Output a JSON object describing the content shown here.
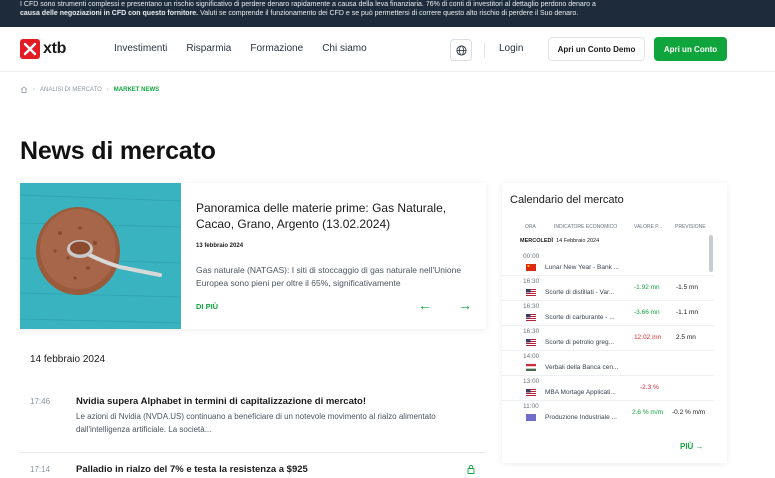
{
  "warning": {
    "line1": "I CFD sono strumenti complessi e presentano un rischio significativo di perdere denaro rapidamente a causa della leva finanziaria. 76% di conti di investitori al dettaglio perdono denaro a",
    "line2_bold": "causa delle negoziazioni in CFD con questo fornitore.",
    "line2_rest": " Valuti se comprende il funzionamento dei CFD e se può permettersi di correre questo alto rischio di perdere il Suo denaro."
  },
  "nav": {
    "logo_text": "xtb",
    "menu": [
      "Investimenti",
      "Risparmia",
      "Formazione",
      "Chi siamo"
    ],
    "login": "Login",
    "demo": "Apri un Conto Demo",
    "open": "Apri un Conto"
  },
  "breadcrumb": {
    "item1": "ANALISI DI MERCATO",
    "item2": "MARKET NEWS"
  },
  "page_title": "News di mercato",
  "featured": {
    "title": "Panoramica delle materie prime: Gas Naturale, Cacao, Grano, Argento (13.02.2024)",
    "date": "13 febbraio 2024",
    "body": "Gas naturale (NATGAS): I siti di stoccaggio di gas naturale nell'Unione Europea sono pieni per oltre il 65%, significativamente",
    "more": "DI PIÙ",
    "prev": "←",
    "next": "→"
  },
  "news": {
    "day_label": "14 febbraio 2024",
    "items": [
      {
        "time": "17:46",
        "title": "Nvidia supera Alphabet in termini di capitalizzazione di mercato!",
        "body": "Le azioni di Nvidia (NVDA.US) continuano a beneficiare di un notevole movimento al rialzo alimentato dall'intelligenza artificiale. La società..."
      },
      {
        "time": "17:14",
        "title": "Palladio in rialzo del 7% e testa la resistenza a $925",
        "body": ""
      }
    ]
  },
  "calendar": {
    "title": "Calendario del mercato",
    "headers": {
      "time": "ORA",
      "indicator": "INDICATORE ECONOMICO",
      "value": "VALORE P...",
      "forecast": "PREVISIONE"
    },
    "day_weekday": "MERCOLEDÌ",
    "day_date": "14 Febbraio 2024",
    "rows": [
      {
        "time": "00:00",
        "name": "Lunar New Year - Bank ...",
        "value": "",
        "forecast": "",
        "flag": "cn"
      },
      {
        "time": "16:30",
        "name": "Scorte di distillati - Var...",
        "value": "-1.92 mn",
        "forecast": "-1.5 mn",
        "flag": "us"
      },
      {
        "time": "16:30",
        "name": "Scorte di carburante - ...",
        "value": "-3.66 mn",
        "forecast": "-1.1 mn",
        "flag": "us"
      },
      {
        "time": "16:30",
        "name": "Scorte di petrolio greg...",
        "value": "12.02 mn",
        "forecast": "2.5 mn",
        "flag": "us"
      },
      {
        "time": "14:00",
        "name": "Verbali della Banca cen...",
        "value": "",
        "forecast": "",
        "flag": "hu"
      },
      {
        "time": "13:00",
        "name": "MBA Mortage Applicati...",
        "value": "-2.3 %",
        "forecast": "",
        "flag": "us"
      },
      {
        "time": "11:00",
        "name": "Produzione Industriale ...",
        "value": "2.6 % m/m",
        "forecast": "-0.2 % m/m",
        "flag": "eu"
      }
    ],
    "more": "PIÙ →"
  },
  "colors": {
    "brand_red": "#e31b23",
    "accent_green": "#10a53c",
    "negative_red": "#e8262d",
    "positive_green": "#10a53c"
  }
}
